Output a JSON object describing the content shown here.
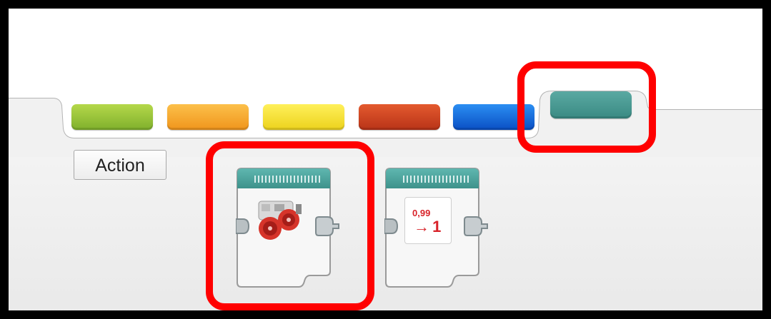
{
  "palette": {
    "category_label": "Action",
    "tabs": [
      {
        "name": "action-tab",
        "color_top": "#b5d84a",
        "color_bottom": "#7fb02c"
      },
      {
        "name": "flow-tab",
        "color_top": "#fcc04a",
        "color_bottom": "#f0951c"
      },
      {
        "name": "sensor-tab",
        "color_top": "#fff05a",
        "color_bottom": "#ecd21c"
      },
      {
        "name": "data-tab",
        "color_top": "#e45a2e",
        "color_bottom": "#b83318"
      },
      {
        "name": "advanced-tab",
        "color_top": "#2b8ef2",
        "color_bottom": "#0a4fc4"
      },
      {
        "name": "my-blocks-tab",
        "color_top": "#5aa9a2",
        "color_bottom": "#3a8a83",
        "selected": true
      }
    ],
    "blocks": [
      {
        "name": "motor-block",
        "icon": "motor-wheels-icon"
      },
      {
        "name": "counter-block",
        "icon": "counter-icon",
        "small_value": "0,99",
        "big_value": "→ 1"
      }
    ]
  },
  "colors": {
    "highlight": "#ff0000",
    "block_header": "#4fa39c"
  }
}
